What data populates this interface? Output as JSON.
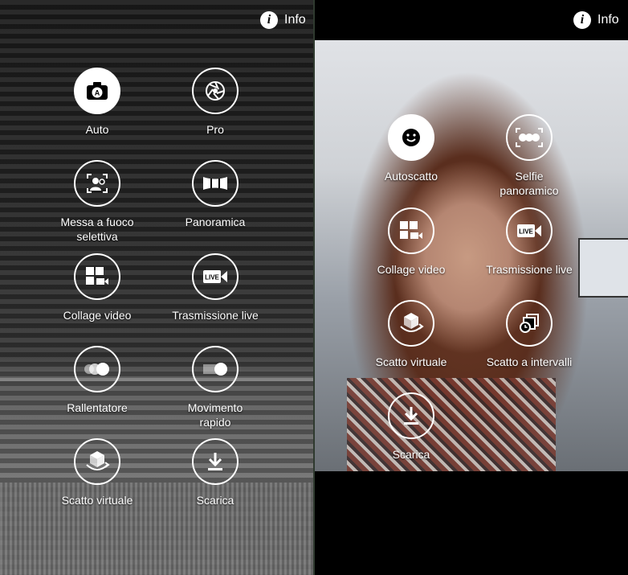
{
  "left": {
    "info_label": "Info",
    "modes": [
      {
        "label": "Auto",
        "icon": "camera-auto-icon",
        "active": true
      },
      {
        "label": "Pro",
        "icon": "aperture-icon",
        "active": false
      },
      {
        "label": "Messa a fuoco\nselettiva",
        "icon": "selective-focus-icon",
        "active": false
      },
      {
        "label": "Panoramica",
        "icon": "panorama-icon",
        "active": false
      },
      {
        "label": "Collage video",
        "icon": "video-collage-icon",
        "active": false
      },
      {
        "label": "Trasmissione live",
        "icon": "live-broadcast-icon",
        "active": false
      },
      {
        "label": "Rallentatore",
        "icon": "slow-motion-icon",
        "active": false
      },
      {
        "label": "Movimento\nrapido",
        "icon": "fast-motion-icon",
        "active": false
      },
      {
        "label": "Scatto virtuale",
        "icon": "virtual-shot-icon",
        "active": false
      },
      {
        "label": "Scarica",
        "icon": "download-icon",
        "active": false
      }
    ]
  },
  "right": {
    "info_label": "Info",
    "modes": [
      {
        "label": "Autoscatto",
        "icon": "selfie-icon",
        "active": true
      },
      {
        "label": "Selfie\npanoramico",
        "icon": "wide-selfie-icon",
        "active": false
      },
      {
        "label": "Collage video",
        "icon": "video-collage-icon",
        "active": false
      },
      {
        "label": "Trasmissione live",
        "icon": "live-broadcast-icon",
        "active": false
      },
      {
        "label": "Scatto virtuale",
        "icon": "virtual-shot-icon",
        "active": false
      },
      {
        "label": "Scatto a intervalli",
        "icon": "interval-shot-icon",
        "active": false
      },
      {
        "label": "Scarica",
        "icon": "download-icon",
        "active": false
      }
    ]
  },
  "icon_badges": {
    "auto": "A",
    "live": "LIVE"
  },
  "colors": {
    "active_fill": "#ffffff",
    "icon_stroke": "#ffffff",
    "active_icon": "#000000"
  }
}
